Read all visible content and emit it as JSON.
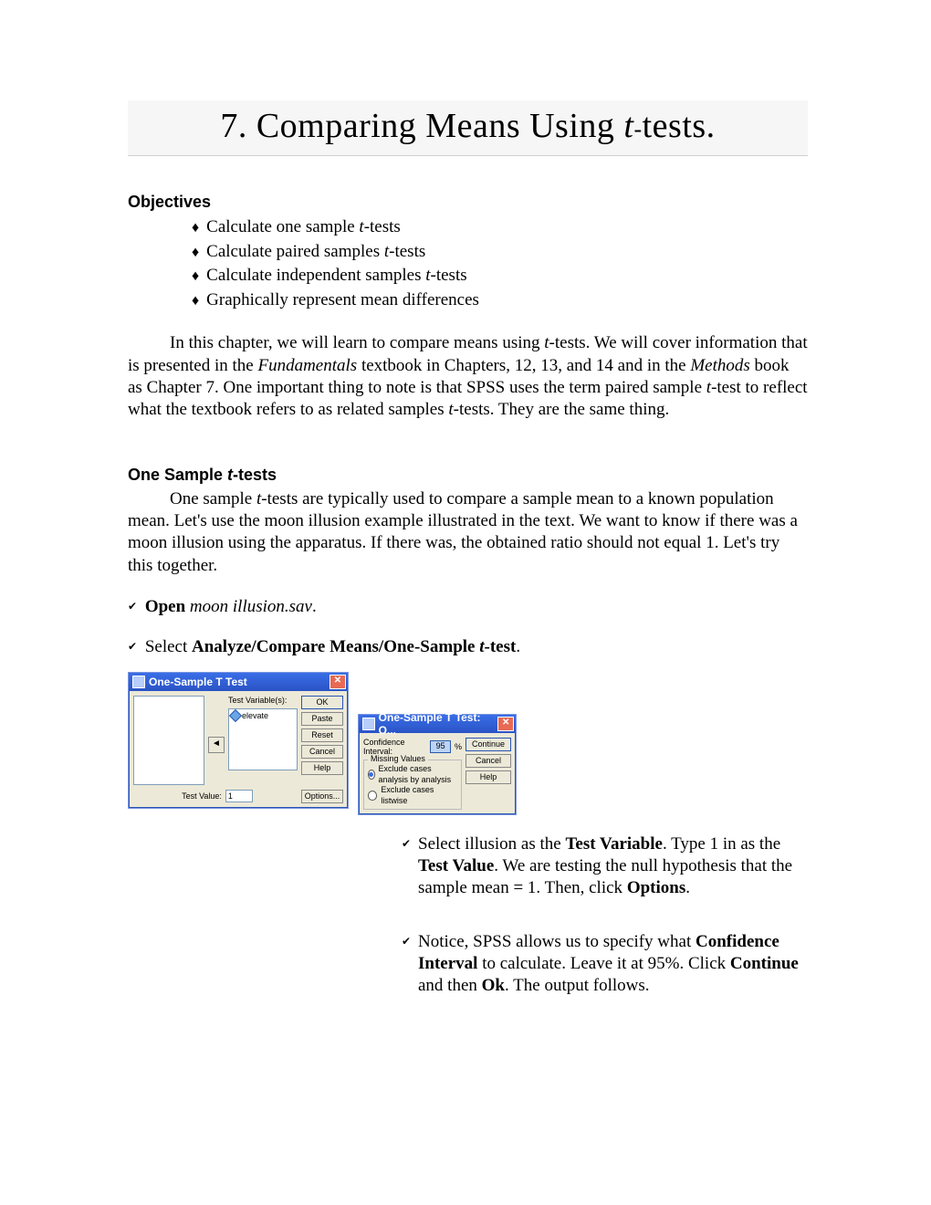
{
  "title": {
    "prefix": "7. Comparing Means Using ",
    "t": "t",
    "dash": "-",
    "suffix": "tests."
  },
  "objectives_heading": "Objectives",
  "objectives": [
    {
      "pre": "Calculate one sample ",
      "it": "t",
      "post": "-tests"
    },
    {
      "pre": "Calculate paired samples ",
      "it": "t",
      "post": "-tests"
    },
    {
      "pre": "Calculate independent samples ",
      "it": "t",
      "post": "-tests"
    },
    {
      "pre": "Graphically represent mean differences",
      "it": "",
      "post": ""
    }
  ],
  "intro": {
    "p1a": "In this chapter, we will learn to compare means using ",
    "p1b": "t",
    "p1c": "-tests.  We will cover information that is presented in the ",
    "p1d": "Fundamentals",
    "p1e": " textbook in Chapters, 12, 13, and 14 and in the ",
    "p1f": "Methods",
    "p1g": " book as Chapter 7.  One important thing to note is that SPSS uses the term paired sample ",
    "p1h": "t",
    "p1i": "-test to reflect what the textbook refers to as related samples ",
    "p1j": "t",
    "p1k": "-tests.  They are the same thing."
  },
  "section2_heading_pre": "One Sample ",
  "section2_heading_it": "t",
  "section2_heading_post": "-tests",
  "section2_para_a": "One sample ",
  "section2_para_b": "t",
  "section2_para_c": "-tests are typically used to compare a sample mean to a known population mean.  Let's use the moon illusion example illustrated in the text.  We want to know if there was a moon illusion using the apparatus.  If there was, the obtained ratio should not equal 1.  Let's try this together.",
  "step_open_bold": "Open",
  "step_open_file": " moon illusion.sav",
  "step_open_dot": ".",
  "step_select_pre": "Select ",
  "step_select_bold_a": "Analyze/Compare Means/One-Sample ",
  "step_select_it": "t",
  "step_select_bold_b": "-test",
  "step_select_dot": ".",
  "dialog1": {
    "title": "One-Sample T Test",
    "test_var_label": "Test Variable(s):",
    "var_item": "elevate",
    "test_value_label": "Test Value:",
    "test_value": "1",
    "buttons": {
      "ok": "OK",
      "paste": "Paste",
      "reset": "Reset",
      "cancel": "Cancel",
      "help": "Help",
      "options": "Options..."
    }
  },
  "dialog2": {
    "title": "One-Sample T Test: O...",
    "ci_label": "Confidence Interval:",
    "ci_value": "95",
    "pct": "%",
    "group_legend": "Missing Values",
    "radio1": "Exclude cases analysis by analysis",
    "radio2": "Exclude cases listwise",
    "buttons": {
      "continue": "Continue",
      "cancel": "Cancel",
      "help": "Help"
    }
  },
  "sidestep1": {
    "a": "Select illusion as the ",
    "b": "Test Variable",
    "c": ".  Type 1 in as the ",
    "d": "Test Value",
    "e": ".  We are testing the null hypothesis that the sample mean = 1.  Then, click ",
    "f": "Options",
    "g": "."
  },
  "sidestep2": {
    "a": "Notice, SPSS allows us to specify what ",
    "b": "Confidence Interval",
    "c": " to calculate.  Leave it at 95%.  Click ",
    "d": "Continue",
    "e": " and then ",
    "f": "Ok",
    "g": ".  The output follows."
  }
}
